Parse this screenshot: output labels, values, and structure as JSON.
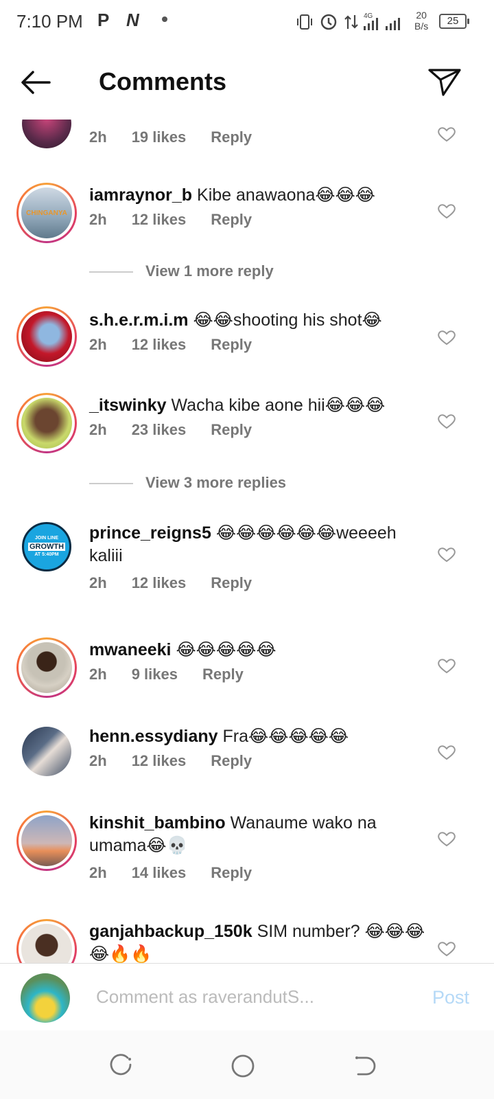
{
  "status_bar": {
    "time": "7:10 PM",
    "notif_icons": [
      "P",
      "N"
    ],
    "net_speed": "20",
    "net_unit": "B/s",
    "battery": "25"
  },
  "header": {
    "title": "Comments"
  },
  "comments": [
    {
      "username": "",
      "text": "",
      "time": "2h",
      "likes": "19 likes",
      "reply": "Reply"
    },
    {
      "username": "iamraynor_b",
      "text": "Kibe anawaona😂😂😂",
      "time": "2h",
      "likes": "12 likes",
      "reply": "Reply"
    },
    {
      "username": "s.h.e.r.m.i.m",
      "text": "😂😂shooting his shot😂",
      "time": "2h",
      "likes": "12 likes",
      "reply": "Reply"
    },
    {
      "username": "_itswinky",
      "text": "Wacha kibe aone hii😂😂😂",
      "time": "2h",
      "likes": "23 likes",
      "reply": "Reply"
    },
    {
      "username": "prince_reigns5",
      "text": "😂😂😂😂😂😂weeeeh kaliii",
      "time": "2h",
      "likes": "12 likes",
      "reply": "Reply"
    },
    {
      "username": "mwaneeki",
      "text": "😂😂😂😂😂",
      "time": "2h",
      "likes": "9 likes",
      "reply": "Reply"
    },
    {
      "username": "henn.essydiany",
      "text": "Fra😂😂😂😂😂",
      "time": "2h",
      "likes": "12 likes",
      "reply": "Reply"
    },
    {
      "username": "kinshit_bambino",
      "text": "Wanaume wako na umama😂💀",
      "time": "2h",
      "likes": "14 likes",
      "reply": "Reply"
    },
    {
      "username": "ganjahbackup_150k",
      "text": "SIM number? 😂😂😂😂🔥🔥",
      "time": "",
      "likes": "",
      "reply": ""
    }
  ],
  "view_more": [
    {
      "label": "View 1 more reply"
    },
    {
      "label": "View 3 more replies"
    }
  ],
  "avatar_texts": {
    "prince_line1": "JOIN LINE",
    "prince_line2": "GROWTH",
    "prince_line3": "AT 5:40PM",
    "raynor": "CHINGANYA"
  },
  "composer": {
    "placeholder": "Comment as raverandutS...",
    "post_label": "Post"
  },
  "colors": {
    "accent_post": "#b5d9f7",
    "ring_a": "#f7a23a",
    "ring_b": "#e4405f"
  }
}
